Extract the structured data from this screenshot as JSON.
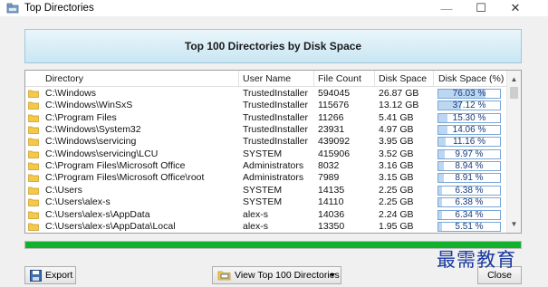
{
  "window": {
    "title": "Top Directories",
    "min_glyph": "—",
    "max_glyph": "☐",
    "close_glyph": "✕"
  },
  "banner": {
    "title": "Top 100 Directories by Disk Space"
  },
  "grid": {
    "columns": [
      "Directory",
      "User Name",
      "File Count",
      "Disk Space",
      "Disk Space (%)"
    ],
    "rows": [
      {
        "directory": "C:\\Windows",
        "user": "TrustedInstaller",
        "files": "594045",
        "space": "26.87 GB",
        "pct": "76.03 %",
        "pct_value": 76.03
      },
      {
        "directory": "C:\\Windows\\WinSxS",
        "user": "TrustedInstaller",
        "files": "115676",
        "space": "13.12 GB",
        "pct": "37.12 %",
        "pct_value": 37.12
      },
      {
        "directory": "C:\\Program Files",
        "user": "TrustedInstaller",
        "files": "11266",
        "space": "5.41 GB",
        "pct": "15.30 %",
        "pct_value": 15.3
      },
      {
        "directory": "C:\\Windows\\System32",
        "user": "TrustedInstaller",
        "files": "23931",
        "space": "4.97 GB",
        "pct": "14.06 %",
        "pct_value": 14.06
      },
      {
        "directory": "C:\\Windows\\servicing",
        "user": "TrustedInstaller",
        "files": "439092",
        "space": "3.95 GB",
        "pct": "11.16 %",
        "pct_value": 11.16
      },
      {
        "directory": "C:\\Windows\\servicing\\LCU",
        "user": "SYSTEM",
        "files": "415906",
        "space": "3.52 GB",
        "pct": "9.97 %",
        "pct_value": 9.97
      },
      {
        "directory": "C:\\Program Files\\Microsoft Office",
        "user": "Administrators",
        "files": "8032",
        "space": "3.16 GB",
        "pct": "8.94 %",
        "pct_value": 8.94
      },
      {
        "directory": "C:\\Program Files\\Microsoft Office\\root",
        "user": "Administrators",
        "files": "7989",
        "space": "3.15 GB",
        "pct": "8.91 %",
        "pct_value": 8.91
      },
      {
        "directory": "C:\\Users",
        "user": "SYSTEM",
        "files": "14135",
        "space": "2.25 GB",
        "pct": "6.38 %",
        "pct_value": 6.38
      },
      {
        "directory": "C:\\Users\\alex-s",
        "user": "SYSTEM",
        "files": "14110",
        "space": "2.25 GB",
        "pct": "6.38 %",
        "pct_value": 6.38
      },
      {
        "directory": "C:\\Users\\alex-s\\AppData",
        "user": "alex-s",
        "files": "14036",
        "space": "2.24 GB",
        "pct": "6.34 %",
        "pct_value": 6.34
      },
      {
        "directory": "C:\\Users\\alex-s\\AppData\\Local",
        "user": "alex-s",
        "files": "13350",
        "space": "1.95 GB",
        "pct": "5.51 %",
        "pct_value": 5.51
      }
    ]
  },
  "progress": {
    "value_percent": 100,
    "color": "#12b12b"
  },
  "footer": {
    "export_label": "Export",
    "view_label": "View Top 100 Directories",
    "close_label": "Close"
  },
  "watermark": {
    "text": "最需教育"
  },
  "icons": {
    "app": "drive-folder-icon",
    "row": "folder-icon",
    "export": "save-icon",
    "view": "folder-icon"
  }
}
